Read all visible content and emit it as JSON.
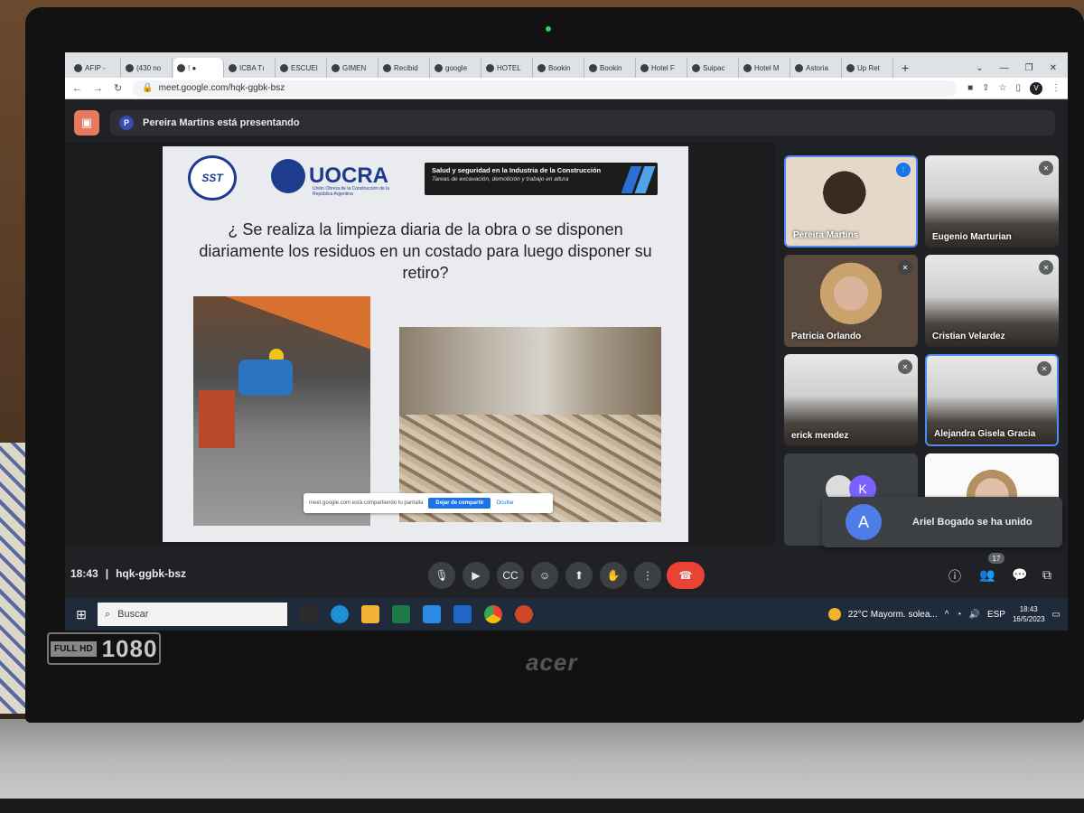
{
  "browser": {
    "tabs": [
      {
        "label": "AFIP -"
      },
      {
        "label": "(430 no"
      },
      {
        "label": "! ●"
      },
      {
        "label": "ICBA Tı"
      },
      {
        "label": "ESCUEI"
      },
      {
        "label": "GIMEN"
      },
      {
        "label": "Recibid"
      },
      {
        "label": "google"
      },
      {
        "label": "HOTEL"
      },
      {
        "label": "Bookin"
      },
      {
        "label": "Bookin"
      },
      {
        "label": "Hotel F"
      },
      {
        "label": "Suipac"
      },
      {
        "label": "Hotel M"
      },
      {
        "label": "Astoria"
      },
      {
        "label": "Up Ret"
      }
    ],
    "new_tab": "+",
    "url": "meet.google.com/hqk-ggbk-bsz",
    "profile_initial": "V"
  },
  "meet": {
    "presenter_initial": "P",
    "presenting_text": "Pereira Martins está presentando",
    "time": "18:43",
    "meeting_code": "hqk-ggbk-bsz",
    "participant_count": "17",
    "toast": {
      "initial": "A",
      "message": "Ariel Bogado se ha unido"
    },
    "participants": [
      {
        "name": "Pereira Martins"
      },
      {
        "name": "Eugenio Marturian"
      },
      {
        "name": "Patricia Orlando"
      },
      {
        "name": "Cristian Velardez"
      },
      {
        "name": "erick mendez"
      },
      {
        "name": "Alejandra Gisela Gracia"
      },
      {
        "name": "",
        "initial": "K"
      },
      {
        "name": ""
      }
    ]
  },
  "slide": {
    "sst_logo": "SST",
    "uocra_logo": "UOCRA",
    "uocra_sub": "Unión Obrera de la Construcción de la República Argentina",
    "banner_title": "Salud y seguridad en la Industria de la Construcción",
    "banner_sub": "Tareas de excavación, demolición y trabajo en altura",
    "question": "¿ Se realiza la limpieza diaria de la obra o se disponen diariamente los residuos en un costado para luego disponer su retiro?",
    "share_notice": {
      "text": "meet.google.com está compartiendo tu pantalla",
      "stop_button": "Dejar de compartir",
      "hide": "Ocultar"
    }
  },
  "taskbar": {
    "search_placeholder": "Buscar",
    "weather": "22°C  Mayorm. solea...",
    "language": "ESP",
    "clock_time": "18:43",
    "clock_date": "16/5/2023"
  },
  "laptop": {
    "badge_hd": "FULL HD",
    "badge_res": "1080",
    "brand": "acer"
  },
  "colors": {
    "meet_bg": "#202124",
    "speaking_border": "#4d8bf5",
    "end_call": "#ea4335",
    "present_icon": "#e8795a"
  }
}
